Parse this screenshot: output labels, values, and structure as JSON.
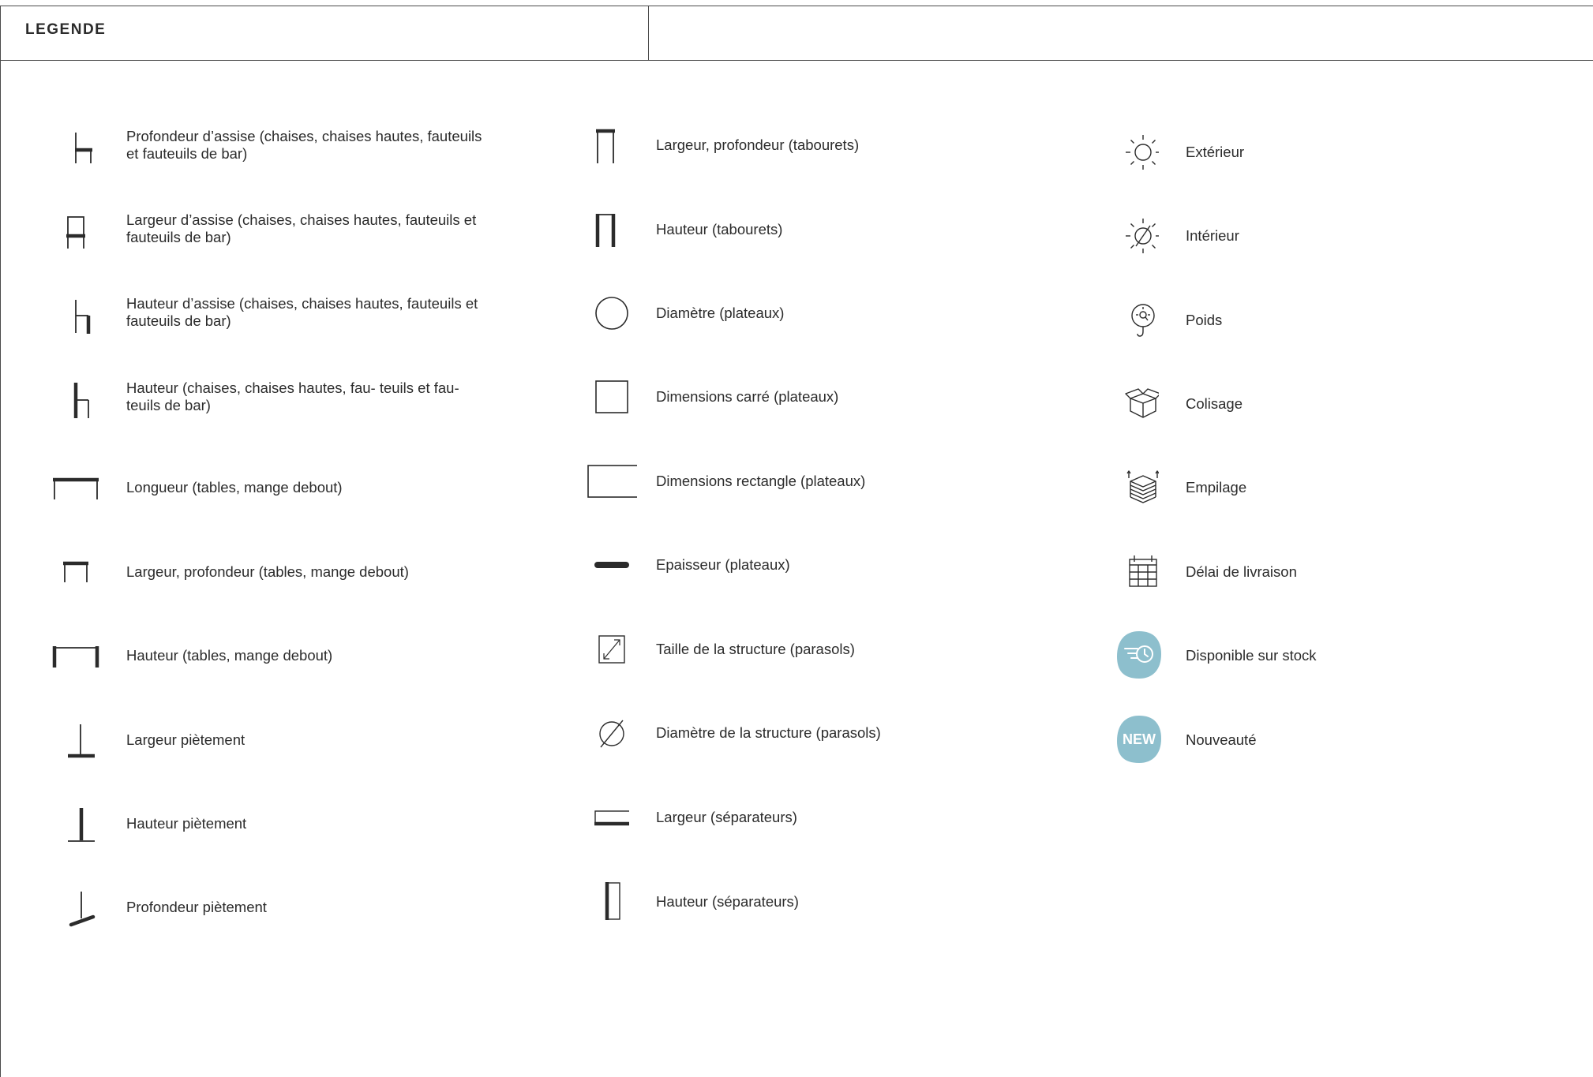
{
  "header": {
    "title": "LEGENDE"
  },
  "columns": [
    {
      "items": [
        {
          "icon": "seat-depth-icon",
          "label": "Profondeur d’assise (chaises, chaises hautes, fauteuils et fauteuils de bar)"
        },
        {
          "icon": "seat-width-icon",
          "label": "Largeur d’assise (chaises, chaises hautes, fauteuils et fauteuils de bar)"
        },
        {
          "icon": "seat-height-icon",
          "label": "Hauteur d’assise (chaises, chaises hautes, fauteuils et fauteuils de bar)"
        },
        {
          "icon": "chair-height-icon",
          "label": "Hauteur (chaises, chaises hautes, fau- teuils et fau- teuils de bar)"
        },
        {
          "icon": "table-length-icon",
          "label": "Longueur (tables, mange debout)"
        },
        {
          "icon": "table-width-depth-icon",
          "label": "Largeur, profondeur (tables, mange debout)"
        },
        {
          "icon": "table-height-icon",
          "label": "Hauteur (tables, mange debout)"
        },
        {
          "icon": "base-width-icon",
          "label": "Largeur piètement"
        },
        {
          "icon": "base-height-icon",
          "label": "Hauteur piètement"
        },
        {
          "icon": "base-depth-icon",
          "label": "Profondeur piètement"
        }
      ]
    },
    {
      "items": [
        {
          "icon": "stool-width-depth-icon",
          "label": "Largeur, profondeur (tabourets)"
        },
        {
          "icon": "stool-height-icon",
          "label": "Hauteur (tabourets)"
        },
        {
          "icon": "diameter-circle-icon",
          "label": "Diamètre (plateaux)"
        },
        {
          "icon": "square-dimensions-icon",
          "label": "Dimensions carré (plateaux)"
        },
        {
          "icon": "rectangle-dimensions-icon",
          "label": "Dimensions rectangle (plateaux)"
        },
        {
          "icon": "thickness-icon",
          "label": "Epaisseur (plateaux)"
        },
        {
          "icon": "structure-size-icon",
          "label": "Taille de la structure (parasols)"
        },
        {
          "icon": "structure-diameter-icon",
          "label": "Diamètre de la structure (parasols)"
        },
        {
          "icon": "divider-width-icon",
          "label": "Largeur (séparateurs)"
        },
        {
          "icon": "divider-height-icon",
          "label": "Hauteur (séparateurs)"
        }
      ]
    },
    {
      "items": [
        {
          "icon": "sun-outdoor-icon",
          "label": "Extérieur"
        },
        {
          "icon": "sun-crossed-indoor-icon",
          "label": "Intérieur"
        },
        {
          "icon": "weight-scale-icon",
          "label": "Poids"
        },
        {
          "icon": "package-box-icon",
          "label": "Colisage"
        },
        {
          "icon": "stacking-icon",
          "label": "Empilage"
        },
        {
          "icon": "calendar-icon",
          "label": "Délai de livraison"
        },
        {
          "icon": "stock-clock-badge-icon",
          "label": "Disponible sur stock"
        },
        {
          "icon": "new-badge-icon",
          "label": "Nouveauté",
          "badge_text": "NEW"
        }
      ]
    }
  ],
  "colors": {
    "badge": "#8dbfcd",
    "line": "#2b2b2b"
  }
}
